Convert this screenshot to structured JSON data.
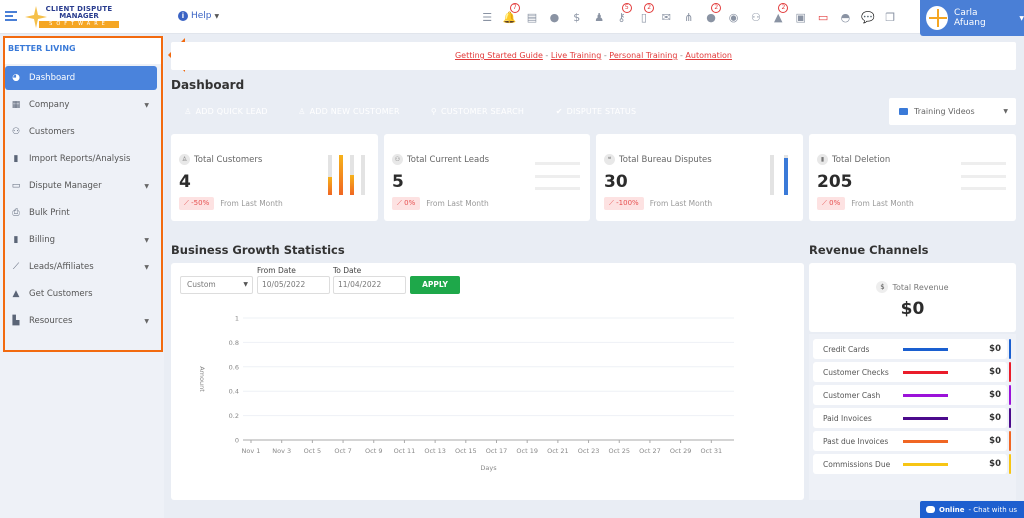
{
  "topbar": {
    "logo": {
      "line1": "CLIENT DISPUTE",
      "line2": "MANAGER",
      "line3": "SOFTWARE"
    },
    "help_label": "Help",
    "icons": [
      {
        "name": "task-list-icon",
        "glyph": "☰",
        "badge": null
      },
      {
        "name": "bell-icon",
        "glyph": "🔔",
        "badge": "7"
      },
      {
        "name": "billing-icon",
        "glyph": "▤",
        "badge": null
      },
      {
        "name": "agent-icon",
        "glyph": "●",
        "badge": null
      },
      {
        "name": "dollar-icon",
        "glyph": "$",
        "badge": null
      },
      {
        "name": "user-tie-icon",
        "glyph": "♟",
        "badge": null
      },
      {
        "name": "key-icon",
        "glyph": "⚷",
        "badge": "5"
      },
      {
        "name": "document-icon",
        "glyph": "▯",
        "badge": "2"
      },
      {
        "name": "mail-icon",
        "glyph": "✉",
        "badge": null
      },
      {
        "name": "sitemap-icon",
        "glyph": "⋔",
        "badge": null
      },
      {
        "name": "info-icon",
        "glyph": "●",
        "badge": "2"
      },
      {
        "name": "globe-icon",
        "glyph": "◉",
        "badge": null
      },
      {
        "name": "users-icon",
        "glyph": "⚇",
        "badge": null
      },
      {
        "name": "warning-icon",
        "glyph": "▲",
        "badge": "2"
      },
      {
        "name": "inbox-calendar-icon",
        "glyph": "▣",
        "badge": null
      },
      {
        "name": "money-bill-icon",
        "glyph": "▭",
        "badge": null,
        "color": "#e23a3a"
      },
      {
        "name": "tray-icon",
        "glyph": "◓",
        "badge": null
      },
      {
        "name": "chat-icon",
        "glyph": "💬",
        "badge": null
      },
      {
        "name": "copy-icon",
        "glyph": "❐",
        "badge": null
      }
    ],
    "user_name": "Carla Afuang"
  },
  "sidebar": {
    "company_name": "BETTER LIVING",
    "items": [
      {
        "label": "Dashboard",
        "icon": "chart-pie-icon",
        "glyph": "◕",
        "active": true,
        "has_caret": false
      },
      {
        "label": "Company",
        "icon": "building-icon",
        "glyph": "▦",
        "active": false,
        "has_caret": true
      },
      {
        "label": "Customers",
        "icon": "users-icon",
        "glyph": "⚇",
        "active": false,
        "has_caret": false
      },
      {
        "label": "Import Reports/Analysis",
        "icon": "file-import-icon",
        "glyph": "▮",
        "active": false,
        "has_caret": false
      },
      {
        "label": "Dispute Manager",
        "icon": "laptop-icon",
        "glyph": "▭",
        "active": false,
        "has_caret": true
      },
      {
        "label": "Bulk Print",
        "icon": "printer-icon",
        "glyph": "⎙",
        "active": false,
        "has_caret": false
      },
      {
        "label": "Billing",
        "icon": "invoice-icon",
        "glyph": "▮",
        "active": false,
        "has_caret": true
      },
      {
        "label": "Leads/Affiliates",
        "icon": "chart-line-icon",
        "glyph": "⟋",
        "active": false,
        "has_caret": true
      },
      {
        "label": "Get Customers",
        "icon": "graduation-cap-icon",
        "glyph": "▲",
        "active": false,
        "has_caret": false
      },
      {
        "label": "Resources",
        "icon": "book-reader-icon",
        "glyph": "▙",
        "active": false,
        "has_caret": true
      }
    ]
  },
  "banner": {
    "links": [
      "Getting Started Guide",
      "Live Training",
      "Personal Training",
      "Automation"
    ],
    "separator": " - "
  },
  "page_title": "Dashboard",
  "quick_actions": [
    {
      "label": "ADD QUICK LEAD",
      "icon": "user-icon",
      "glyph": "♙",
      "color": "#19a24f"
    },
    {
      "label": "ADD NEW CUSTOMER",
      "icon": "user-icon",
      "glyph": "♙",
      "color": "#f06623"
    },
    {
      "label": "CUSTOMER SEARCH",
      "icon": "search-icon",
      "glyph": "⚲",
      "color": "#fbb01e"
    },
    {
      "label": "DISPUTE STATUS",
      "icon": "check-circle-icon",
      "glyph": "✔",
      "color": "#ea1c2a"
    }
  ],
  "training_videos": {
    "label": "Training Videos"
  },
  "stats": [
    {
      "label": "Total Customers",
      "icon": "user-icon",
      "glyph": "♙",
      "value": "4",
      "change": "-50%",
      "change_label": "From Last Month"
    },
    {
      "label": "Total Current Leads",
      "icon": "users-icon",
      "glyph": "⚇",
      "value": "5",
      "change": "0%",
      "change_label": "From Last Month"
    },
    {
      "label": "Total Bureau Disputes",
      "icon": "comments-icon",
      "glyph": "❝",
      "value": "30",
      "change": "-100%",
      "change_label": "From Last Month"
    },
    {
      "label": "Total Deletion",
      "icon": "trash-icon",
      "glyph": "▮",
      "value": "205",
      "change": "0%",
      "change_label": "From Last Month"
    }
  ],
  "business_growth": {
    "title": "Business Growth Statistics",
    "range_select": "Custom",
    "from_label": "From Date",
    "from_value": "10/05/2022",
    "to_label": "To Date",
    "to_value": "11/04/2022",
    "apply_label": "APPLY"
  },
  "chart_data": {
    "type": "line",
    "title": "",
    "xlabel": "Days",
    "ylabel": "Amount",
    "x": [
      "Nov 1",
      "Nov 3",
      "Oct 5",
      "Oct 7",
      "Oct 9",
      "Oct 11",
      "Oct 13",
      "Oct 15",
      "Oct 17",
      "Oct 19",
      "Oct 21",
      "Oct 23",
      "Oct 25",
      "Oct 27",
      "Oct 29",
      "Oct 31"
    ],
    "yticks": [
      "0",
      "0.2",
      "0.4",
      "0.6",
      "0.8",
      "1"
    ],
    "ylim": [
      0,
      1
    ],
    "series": [],
    "grid": true
  },
  "revenue": {
    "title": "Revenue Channels",
    "total_label": "Total Revenue",
    "total_icon": "dollar-icon",
    "total_value": "$0",
    "channels": [
      {
        "label": "Credit Cards",
        "value": "$0",
        "color": "#1a5fd0"
      },
      {
        "label": "Customer Checks",
        "value": "$0",
        "color": "#ea1c2a"
      },
      {
        "label": "Customer Cash",
        "value": "$0",
        "color": "#9b12d9"
      },
      {
        "label": "Paid Invoices",
        "value": "$0",
        "color": "#4b0a8c"
      },
      {
        "label": "Past due Invoices",
        "value": "$0",
        "color": "#f06623"
      },
      {
        "label": "Commissions Due",
        "value": "$0",
        "color": "#f7c514"
      }
    ]
  },
  "chat_widget": {
    "status": "Online",
    "label": "- Chat with us"
  }
}
